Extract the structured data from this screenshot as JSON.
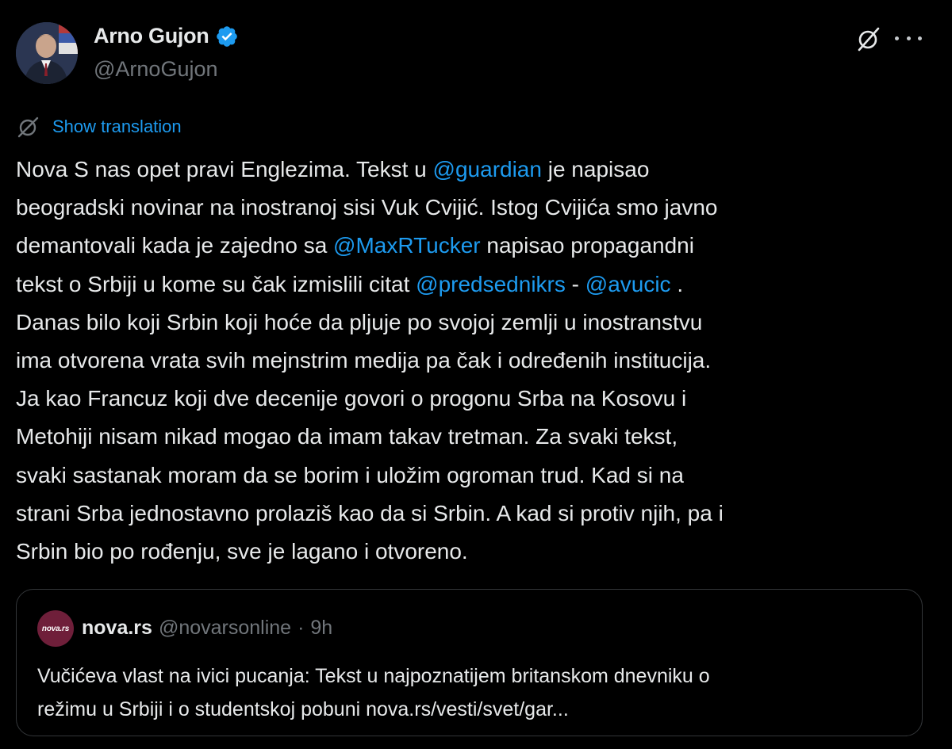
{
  "author": {
    "name": "Arno Gujon",
    "handle": "@ArnoGujon",
    "verified": true,
    "avatar_icon": "avatar-photo"
  },
  "actions": {
    "grok_icon": "grok-icon",
    "more_icon": "more-options-icon"
  },
  "translation": {
    "icon": "translate-icon",
    "label": "Show translation"
  },
  "tweet_lines": [
    [
      {
        "t": "Nova S nas opet pravi Englezima. Tekst u "
      },
      {
        "t": "@guardian",
        "m": true
      },
      {
        "t": " je napisao"
      }
    ],
    [
      {
        "t": "beogradski novinar na inostranoj sisi Vuk Cvijić. Istog Cvijića smo javno"
      }
    ],
    [
      {
        "t": "demantovali kada je zajedno sa  "
      },
      {
        "t": "@MaxRTucker",
        "m": true
      },
      {
        "t": " napisao propagandni"
      }
    ],
    [
      {
        "t": "tekst o Srbiji u kome su čak izmislili citat "
      },
      {
        "t": "@predsednikrs",
        "m": true
      },
      {
        "t": " - "
      },
      {
        "t": "@avucic",
        "m": true
      },
      {
        "t": " ."
      }
    ],
    [
      {
        "t": "Danas bilo koji Srbin koji hoće da pljuje po svojoj zemlji u inostranstvu"
      }
    ],
    [
      {
        "t": "ima otvorena vrata svih mejnstrim medija pa čak i određenih institucija."
      }
    ],
    [
      {
        "t": "Ja kao Francuz koji dve decenije govori o progonu Srba na Kosovu i"
      }
    ],
    [
      {
        "t": "Metohiji nisam nikad mogao da imam takav tretman. Za svaki tekst,"
      }
    ],
    [
      {
        "t": "svaki sastanak moram da se borim i uložim ogroman trud. Kad si na"
      }
    ],
    [
      {
        "t": "strani Srba jednostavno prolaziš kao da si Srbin. A kad si protiv njih, pa i"
      }
    ],
    [
      {
        "t": "Srbin bio po rođenju, sve je lagano i otvoreno."
      }
    ]
  ],
  "quote": {
    "logo_text": "nova.rs",
    "name": "nova.rs",
    "handle": "@novarsonline",
    "separator": "·",
    "time": "9h",
    "lines": [
      "Vučićeva vlast na ivici pucanja: Tekst u najpoznatijem britanskom dnevniku o",
      "režimu u Srbiji i o studentskoj pobuni nova.rs/vesti/svet/gar..."
    ]
  },
  "colors": {
    "background": "#000000",
    "text": "#e7e9ea",
    "secondary": "#71767b",
    "accent": "#1d9bf0",
    "border": "#333639"
  }
}
